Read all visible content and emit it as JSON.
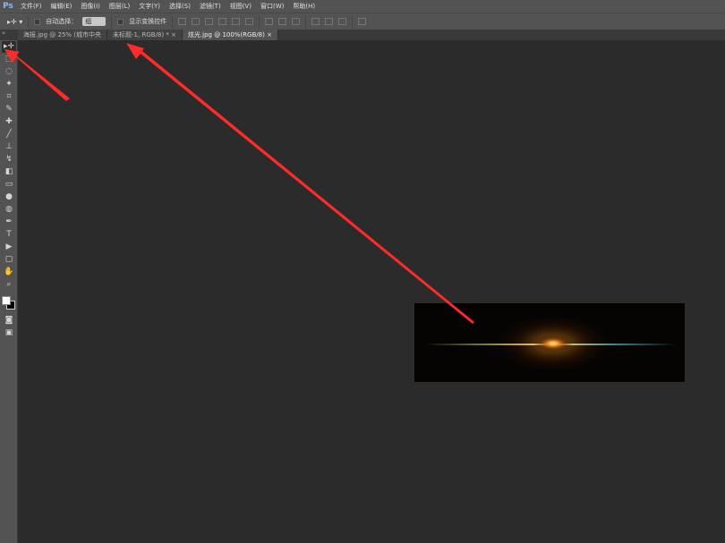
{
  "app": {
    "logo": "Ps"
  },
  "menu": [
    "文件(F)",
    "编辑(E)",
    "图像(I)",
    "图层(L)",
    "文字(Y)",
    "选择(S)",
    "滤镜(T)",
    "视图(V)",
    "窗口(W)",
    "帮助(H)"
  ],
  "options": {
    "auto_select_label": "自动选择：",
    "auto_select_value": "组",
    "show_transform_label": "显示变换控件"
  },
  "tabs": [
    {
      "label": "海报.jpg @ 25% (城市中央",
      "active": false
    },
    {
      "label": "未标题-1, RGB/8) *",
      "close": "×",
      "active": false
    },
    {
      "label": "炫光.jpg @ 100%(RGB/8)",
      "close": "×",
      "active": true
    }
  ],
  "tools": [
    "move-icon",
    "marquee-icon",
    "lasso-icon",
    "magic-wand-icon",
    "crop-icon",
    "eyedropper-icon",
    "healing-brush-icon",
    "brush-icon",
    "clone-stamp-icon",
    "history-brush-icon",
    "eraser-icon",
    "gradient-icon",
    "blur-icon",
    "dodge-icon",
    "pen-icon",
    "type-icon",
    "path-selection-icon",
    "shape-icon",
    "hand-icon",
    "zoom-icon"
  ],
  "tool_glyphs": [
    "▸✛",
    "⬚",
    "◌",
    "✦",
    "⌗",
    "✎",
    "✚",
    "╱",
    "⊥",
    "↯",
    "◧",
    "▭",
    "●",
    "◍",
    "✒",
    "T",
    "▶",
    "▢",
    "✋",
    "⌕"
  ],
  "colors": {
    "foreground": "#ffffff",
    "background": "#000000",
    "arrow": "#ff2a2a",
    "flare": "#ff9a1a"
  }
}
